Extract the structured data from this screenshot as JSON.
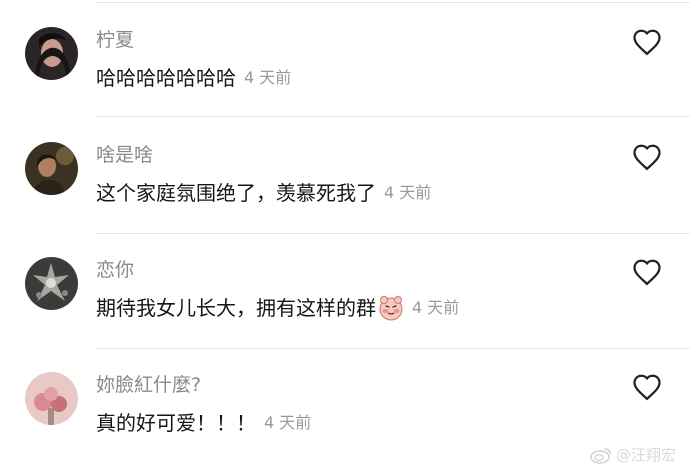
{
  "comments": [
    {
      "username": "柠夏",
      "text": "哈哈哈哈哈哈哈",
      "time": "4 天前",
      "avatar": "avatar-woman-dark-hair",
      "liked": false
    },
    {
      "username": "啥是啥",
      "text": "这个家庭氛围绝了，羡慕死我了",
      "time": "4 天前",
      "avatar": "avatar-person-in-dim-room",
      "liked": false
    },
    {
      "username": "恋你",
      "text": "期待我女儿长大，拥有这样的群",
      "emoji": "blushing-bear-emoji",
      "time": "4 天前",
      "avatar": "avatar-chandelier",
      "liked": false
    },
    {
      "username": "妳臉紅什麼?",
      "text": "真的好可爱！！！",
      "time": "4 天前",
      "avatar": "avatar-pink-flowers",
      "liked": false
    }
  ],
  "icons": {
    "like": "heart-outline-icon"
  },
  "colors": {
    "username": "#8a8a8a",
    "text": "#161616",
    "time": "#9a9a9a",
    "divider": "#e6e6e6"
  },
  "watermark": {
    "handle": "@汪翔宏",
    "icon": "weibo-logo-icon"
  }
}
